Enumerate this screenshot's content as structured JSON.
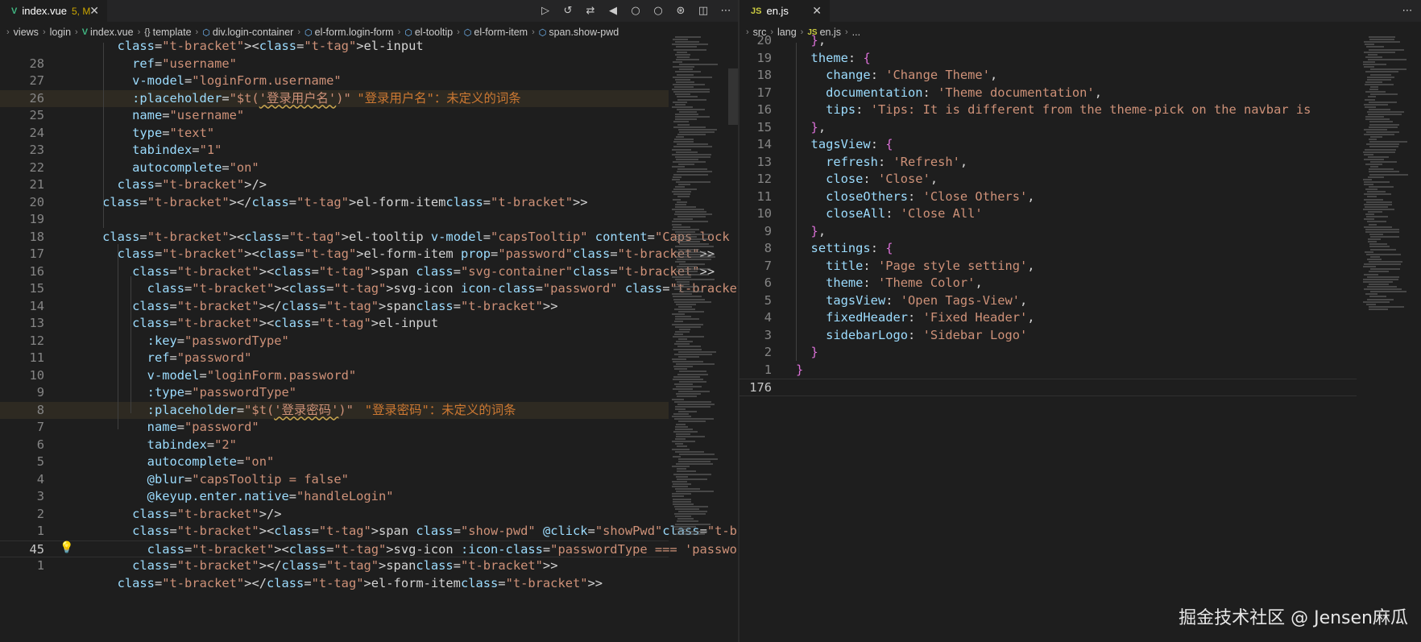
{
  "colors": {
    "editor_bg": "#1e1e1e",
    "tab_bar_bg": "#252526",
    "vue_icon": "#41b883",
    "js_icon": "#cbcb41",
    "modified": "#cca700"
  },
  "left_editor": {
    "tab": {
      "icon": "vue-icon",
      "label": "index.vue",
      "status": "5, M"
    },
    "breadcrumb": [
      {
        "label": "views",
        "icon": ""
      },
      {
        "label": "login",
        "icon": ""
      },
      {
        "label": "index.vue",
        "icon": "vue-icon"
      },
      {
        "label": "template",
        "icon": "braces-icon"
      },
      {
        "label": "div.login-container",
        "icon": "element-icon"
      },
      {
        "label": "el-form.login-form",
        "icon": "element-icon"
      },
      {
        "label": "el-tooltip",
        "icon": "element-icon"
      },
      {
        "label": "el-form-item",
        "icon": "element-icon"
      },
      {
        "label": "span.show-pwd",
        "icon": "element-icon"
      }
    ],
    "lines": [
      {
        "num": "",
        "text": "      <el-input"
      },
      {
        "num": "28",
        "text": "        ref=\"username\""
      },
      {
        "num": "27",
        "text": "        v-model=\"loginForm.username\""
      },
      {
        "num": "26",
        "text": "        :placeholder=\"$t('登录用户名')\"",
        "ghost": "\"登录用户名\"：未定义的词条"
      },
      {
        "num": "25",
        "text": "        name=\"username\""
      },
      {
        "num": "24",
        "text": "        type=\"text\""
      },
      {
        "num": "23",
        "text": "        tabindex=\"1\""
      },
      {
        "num": "22",
        "text": "        autocomplete=\"on\""
      },
      {
        "num": "21",
        "text": "      />"
      },
      {
        "num": "20",
        "text": "    </el-form-item>"
      },
      {
        "num": "19",
        "text": ""
      },
      {
        "num": "18",
        "text": "    <el-tooltip v-model=\"capsTooltip\" content=\"Caps lock is On\" placement"
      },
      {
        "num": "17",
        "text": "      <el-form-item prop=\"password\">"
      },
      {
        "num": "16",
        "text": "        <span class=\"svg-container\">"
      },
      {
        "num": "15",
        "text": "          <svg-icon icon-class=\"password\" />"
      },
      {
        "num": "14",
        "text": "        </span>"
      },
      {
        "num": "13",
        "text": "        <el-input"
      },
      {
        "num": "12",
        "text": "          :key=\"passwordType\""
      },
      {
        "num": "11",
        "text": "          ref=\"password\""
      },
      {
        "num": "10",
        "text": "          v-model=\"loginForm.password\""
      },
      {
        "num": "9",
        "text": "          :type=\"passwordType\""
      },
      {
        "num": "8",
        "text": "          :placeholder=\"$t('登录密码')\"",
        "ghost": "\"登录密码\"：未定义的词条"
      },
      {
        "num": "7",
        "text": "          name=\"password\""
      },
      {
        "num": "6",
        "text": "          tabindex=\"2\""
      },
      {
        "num": "5",
        "text": "          autocomplete=\"on\""
      },
      {
        "num": "4",
        "text": "          @blur=\"capsTooltip = false\""
      },
      {
        "num": "3",
        "text": "          @keyup.enter.native=\"handleLogin\""
      },
      {
        "num": "2",
        "text": "        />"
      },
      {
        "num": "1",
        "text": "        <span class=\"show-pwd\" @click=\"showPwd\">"
      },
      {
        "num": "45",
        "text": "          <svg-icon :icon-class=\"passwordType === 'password' ? 'eye' : 'e"
      },
      {
        "num": "1",
        "text": "        </span>"
      },
      {
        "num": "",
        "text": "      </el-form-item>"
      }
    ]
  },
  "right_editor": {
    "tab": {
      "icon": "js-icon",
      "label": "en.js"
    },
    "breadcrumb": [
      {
        "label": "src",
        "icon": ""
      },
      {
        "label": "lang",
        "icon": ""
      },
      {
        "label": "en.js",
        "icon": "js-icon"
      },
      {
        "label": "...",
        "icon": ""
      }
    ],
    "lines": [
      {
        "num": "20",
        "text": "  },"
      },
      {
        "num": "19",
        "text": "  theme: {"
      },
      {
        "num": "18",
        "text": "    change: 'Change Theme',"
      },
      {
        "num": "17",
        "text": "    documentation: 'Theme documentation',"
      },
      {
        "num": "16",
        "text": "    tips: 'Tips: It is different from the theme-pick on the navbar is"
      },
      {
        "num": "15",
        "text": "  },"
      },
      {
        "num": "14",
        "text": "  tagsView: {"
      },
      {
        "num": "13",
        "text": "    refresh: 'Refresh',"
      },
      {
        "num": "12",
        "text": "    close: 'Close',"
      },
      {
        "num": "11",
        "text": "    closeOthers: 'Close Others',"
      },
      {
        "num": "10",
        "text": "    closeAll: 'Close All'"
      },
      {
        "num": "9",
        "text": "  },"
      },
      {
        "num": "8",
        "text": "  settings: {"
      },
      {
        "num": "7",
        "text": "    title: 'Page style setting',"
      },
      {
        "num": "6",
        "text": "    theme: 'Theme Color',"
      },
      {
        "num": "5",
        "text": "    tagsView: 'Open Tags-View',"
      },
      {
        "num": "4",
        "text": "    fixedHeader: 'Fixed Header',"
      },
      {
        "num": "3",
        "text": "    sidebarLogo: 'Sidebar Logo'"
      },
      {
        "num": "2",
        "text": "  }"
      },
      {
        "num": "1",
        "text": "}"
      },
      {
        "num": "176",
        "text": ""
      }
    ]
  },
  "toolbar_icons": [
    "run-icon",
    "history-icon",
    "git-compare-icon",
    "go-back-icon",
    "circle-icon",
    "circle-icon",
    "git-lens-icon",
    "split-editor-icon",
    "more-icon"
  ],
  "watermark": "掘金技术社区 @ Jensen麻瓜"
}
